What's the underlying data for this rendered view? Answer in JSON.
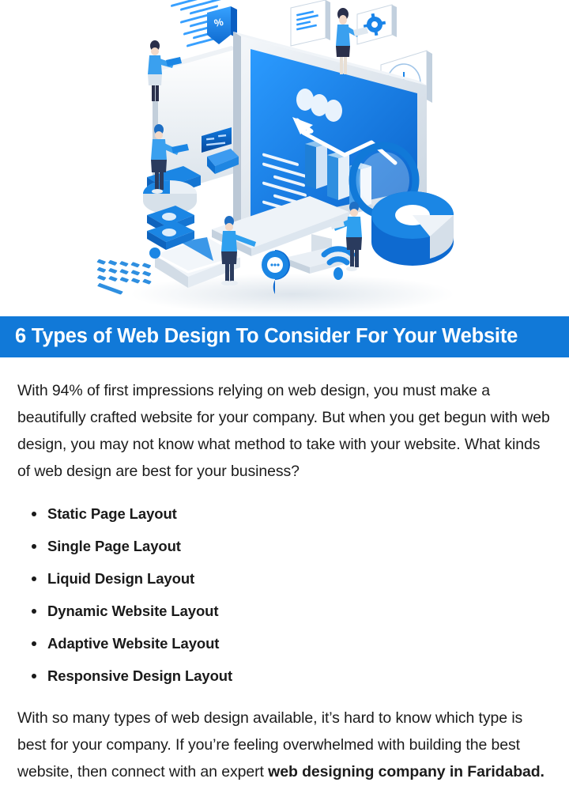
{
  "hero": {
    "alt": "Isometric illustration of web design workspace with monitor, keyboard, charts and people",
    "elements": [
      {
        "name": "desktop-monitor-icon",
        "label": "Desktop monitor with code and charts"
      },
      {
        "name": "keyboard-icon",
        "label": "Keyboard"
      },
      {
        "name": "mouse-icon",
        "label": "Mouse"
      },
      {
        "name": "magnifier-icon",
        "label": "Magnifying glass"
      },
      {
        "name": "gear-icon",
        "label": "Settings gear card"
      },
      {
        "name": "clock-icon",
        "label": "Clock card"
      },
      {
        "name": "document-icon",
        "label": "Document card"
      },
      {
        "name": "percent-tag-icon",
        "label": "Percent discount tag"
      },
      {
        "name": "wifi-icon",
        "label": "WiFi signal"
      },
      {
        "name": "chat-pin-icon",
        "label": "Chat bubble pin"
      },
      {
        "name": "pie-chart-icon",
        "label": "Pie chart"
      },
      {
        "name": "donut-chart-icon",
        "label": "Donut chart"
      },
      {
        "name": "envelope-icon",
        "label": "Envelope mail"
      },
      {
        "name": "server-stack-icon",
        "label": "Server stack"
      },
      {
        "name": "person-figure",
        "label": "Person working"
      }
    ],
    "colors": {
      "primary_blue": "#1179d8",
      "accent_blue": "#1f8ff2",
      "deep_blue": "#0b5fbd",
      "light_gray": "#e8edf2",
      "white": "#ffffff"
    }
  },
  "banner": {
    "title": "6 Types of Web Design To Consider For Your Website",
    "background_color": "#1179d8",
    "text_color": "#ffffff"
  },
  "article": {
    "intro_paragraph": "With 94% of first impressions relying on web design, you must make a beautifully crafted website for your company. But when you get begun with web design, you may not know what method to take with your website. What kinds of web design are best for your business?",
    "list": [
      "Static Page Layout",
      "Single Page Layout",
      "Liquid Design Layout",
      "Dynamic Website Layout",
      "Adaptive Website Layout",
      "Responsive Design Layout"
    ],
    "outro_plain": "With so many types of web design available, it’s hard to know which type is best for your company. If you’re feeling overwhelmed with building the best website, then connect with an expert ",
    "outro_bold": "web designing company in Faridabad."
  }
}
